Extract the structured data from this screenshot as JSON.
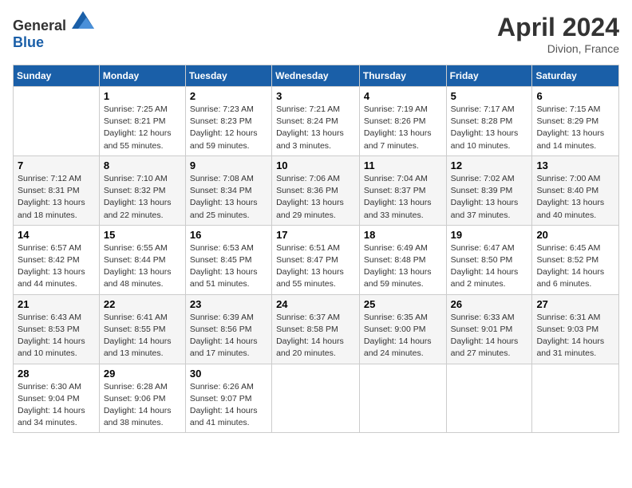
{
  "header": {
    "logo_general": "General",
    "logo_blue": "Blue",
    "title": "April 2024",
    "location": "Divion, France"
  },
  "calendar": {
    "days_of_week": [
      "Sunday",
      "Monday",
      "Tuesday",
      "Wednesday",
      "Thursday",
      "Friday",
      "Saturday"
    ],
    "weeks": [
      [
        {
          "day": "",
          "info": ""
        },
        {
          "day": "1",
          "info": "Sunrise: 7:25 AM\nSunset: 8:21 PM\nDaylight: 12 hours\nand 55 minutes."
        },
        {
          "day": "2",
          "info": "Sunrise: 7:23 AM\nSunset: 8:23 PM\nDaylight: 12 hours\nand 59 minutes."
        },
        {
          "day": "3",
          "info": "Sunrise: 7:21 AM\nSunset: 8:24 PM\nDaylight: 13 hours\nand 3 minutes."
        },
        {
          "day": "4",
          "info": "Sunrise: 7:19 AM\nSunset: 8:26 PM\nDaylight: 13 hours\nand 7 minutes."
        },
        {
          "day": "5",
          "info": "Sunrise: 7:17 AM\nSunset: 8:28 PM\nDaylight: 13 hours\nand 10 minutes."
        },
        {
          "day": "6",
          "info": "Sunrise: 7:15 AM\nSunset: 8:29 PM\nDaylight: 13 hours\nand 14 minutes."
        }
      ],
      [
        {
          "day": "7",
          "info": "Sunrise: 7:12 AM\nSunset: 8:31 PM\nDaylight: 13 hours\nand 18 minutes."
        },
        {
          "day": "8",
          "info": "Sunrise: 7:10 AM\nSunset: 8:32 PM\nDaylight: 13 hours\nand 22 minutes."
        },
        {
          "day": "9",
          "info": "Sunrise: 7:08 AM\nSunset: 8:34 PM\nDaylight: 13 hours\nand 25 minutes."
        },
        {
          "day": "10",
          "info": "Sunrise: 7:06 AM\nSunset: 8:36 PM\nDaylight: 13 hours\nand 29 minutes."
        },
        {
          "day": "11",
          "info": "Sunrise: 7:04 AM\nSunset: 8:37 PM\nDaylight: 13 hours\nand 33 minutes."
        },
        {
          "day": "12",
          "info": "Sunrise: 7:02 AM\nSunset: 8:39 PM\nDaylight: 13 hours\nand 37 minutes."
        },
        {
          "day": "13",
          "info": "Sunrise: 7:00 AM\nSunset: 8:40 PM\nDaylight: 13 hours\nand 40 minutes."
        }
      ],
      [
        {
          "day": "14",
          "info": "Sunrise: 6:57 AM\nSunset: 8:42 PM\nDaylight: 13 hours\nand 44 minutes."
        },
        {
          "day": "15",
          "info": "Sunrise: 6:55 AM\nSunset: 8:44 PM\nDaylight: 13 hours\nand 48 minutes."
        },
        {
          "day": "16",
          "info": "Sunrise: 6:53 AM\nSunset: 8:45 PM\nDaylight: 13 hours\nand 51 minutes."
        },
        {
          "day": "17",
          "info": "Sunrise: 6:51 AM\nSunset: 8:47 PM\nDaylight: 13 hours\nand 55 minutes."
        },
        {
          "day": "18",
          "info": "Sunrise: 6:49 AM\nSunset: 8:48 PM\nDaylight: 13 hours\nand 59 minutes."
        },
        {
          "day": "19",
          "info": "Sunrise: 6:47 AM\nSunset: 8:50 PM\nDaylight: 14 hours\nand 2 minutes."
        },
        {
          "day": "20",
          "info": "Sunrise: 6:45 AM\nSunset: 8:52 PM\nDaylight: 14 hours\nand 6 minutes."
        }
      ],
      [
        {
          "day": "21",
          "info": "Sunrise: 6:43 AM\nSunset: 8:53 PM\nDaylight: 14 hours\nand 10 minutes."
        },
        {
          "day": "22",
          "info": "Sunrise: 6:41 AM\nSunset: 8:55 PM\nDaylight: 14 hours\nand 13 minutes."
        },
        {
          "day": "23",
          "info": "Sunrise: 6:39 AM\nSunset: 8:56 PM\nDaylight: 14 hours\nand 17 minutes."
        },
        {
          "day": "24",
          "info": "Sunrise: 6:37 AM\nSunset: 8:58 PM\nDaylight: 14 hours\nand 20 minutes."
        },
        {
          "day": "25",
          "info": "Sunrise: 6:35 AM\nSunset: 9:00 PM\nDaylight: 14 hours\nand 24 minutes."
        },
        {
          "day": "26",
          "info": "Sunrise: 6:33 AM\nSunset: 9:01 PM\nDaylight: 14 hours\nand 27 minutes."
        },
        {
          "day": "27",
          "info": "Sunrise: 6:31 AM\nSunset: 9:03 PM\nDaylight: 14 hours\nand 31 minutes."
        }
      ],
      [
        {
          "day": "28",
          "info": "Sunrise: 6:30 AM\nSunset: 9:04 PM\nDaylight: 14 hours\nand 34 minutes."
        },
        {
          "day": "29",
          "info": "Sunrise: 6:28 AM\nSunset: 9:06 PM\nDaylight: 14 hours\nand 38 minutes."
        },
        {
          "day": "30",
          "info": "Sunrise: 6:26 AM\nSunset: 9:07 PM\nDaylight: 14 hours\nand 41 minutes."
        },
        {
          "day": "",
          "info": ""
        },
        {
          "day": "",
          "info": ""
        },
        {
          "day": "",
          "info": ""
        },
        {
          "day": "",
          "info": ""
        }
      ]
    ]
  }
}
